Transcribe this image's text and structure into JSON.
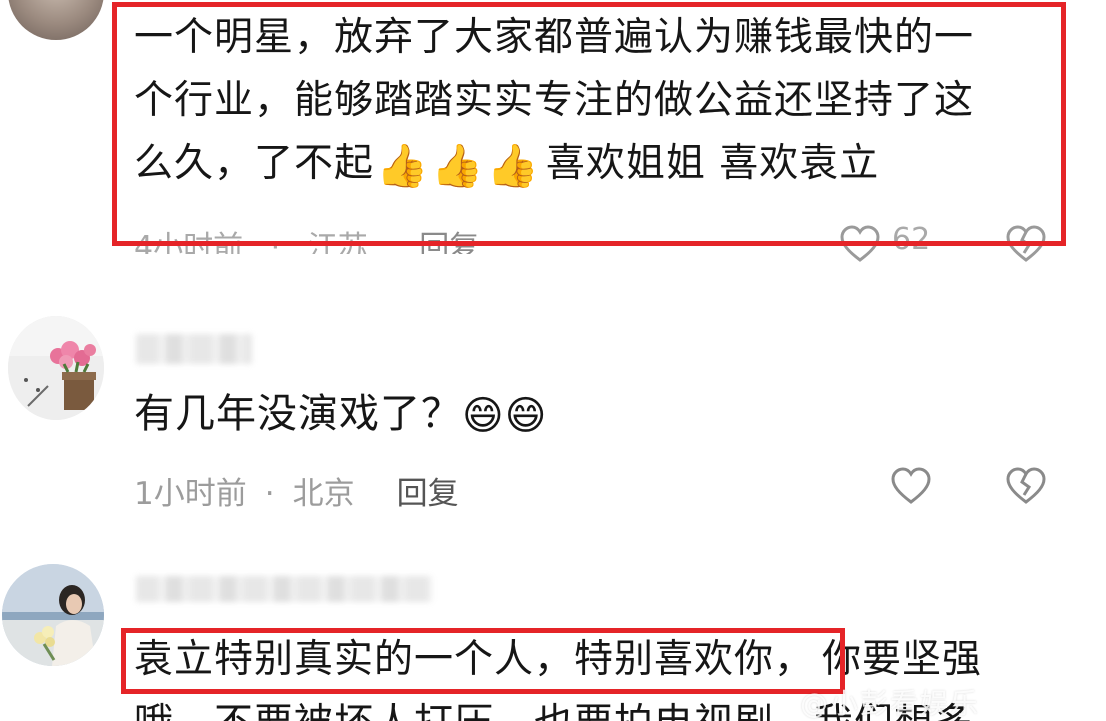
{
  "comments": [
    {
      "text_lines": [
        "一个明星，放弃了大家都普遍认为赚钱最快的一",
        "个行业，能够踏踏实实专注的做公益还坚持了这",
        "么久，了不起"
      ],
      "text_tail": "喜欢姐姐 喜欢袁立",
      "thumbs": [
        "👍",
        "👍",
        "👍"
      ],
      "time": "4小时前",
      "location": "江苏",
      "reply_label": "回复",
      "like_count": "62"
    },
    {
      "text": "有几年没演戏了？",
      "emojis": [
        "😄",
        "😄"
      ],
      "time": "1小时前",
      "location": "北京",
      "reply_label": "回复"
    },
    {
      "text_highlight": "袁立特别真实的一个人，特别喜欢你，",
      "text_rest": "你要坚强",
      "text_line2": "哦，不要被坏人打压，也要拍电视剧，我们想多"
    }
  ],
  "meta_separator": "·",
  "highlight_color": "#e52428",
  "watermark": "@小彭看娱乐"
}
